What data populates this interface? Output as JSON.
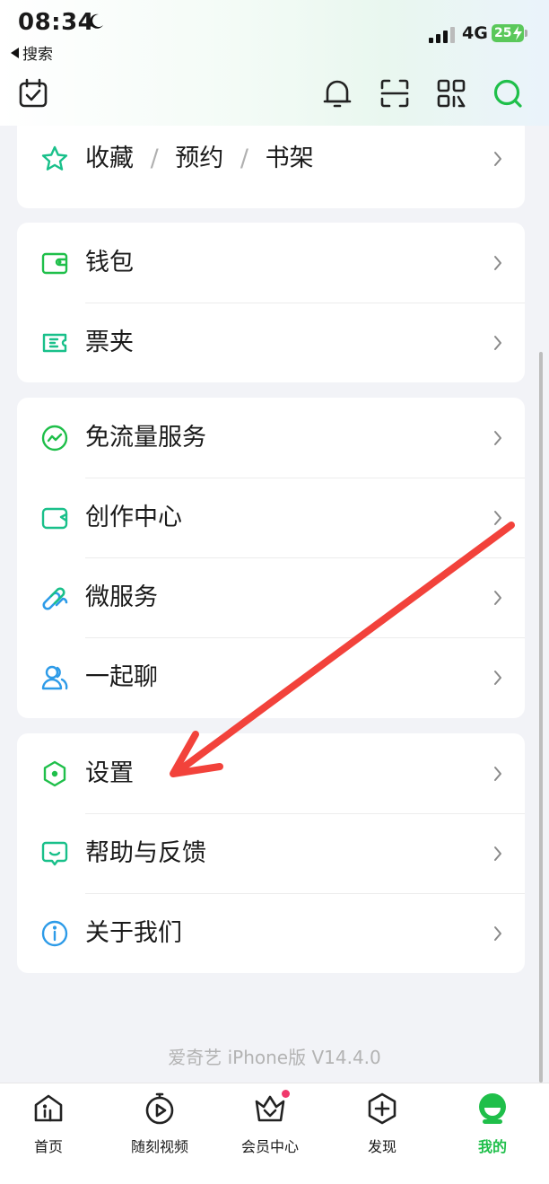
{
  "status_bar": {
    "time": "08:34",
    "back_label": "搜索",
    "network": "4G",
    "battery": "25"
  },
  "header_icons": [
    "calendar-check-icon",
    "bell-icon",
    "scan-icon",
    "qr-code-icon",
    "search-icon"
  ],
  "menu": {
    "favorites": {
      "label_a": "收藏",
      "sep1": "/",
      "label_b": "预约",
      "sep2": "/",
      "label_c": "书架"
    },
    "wallet": "钱包",
    "tickets": "票夹",
    "free_data": "免流量服务",
    "creator_center": "创作中心",
    "micro_services": "微服务",
    "chat_together": "一起聊",
    "settings": "设置",
    "help_feedback": "帮助与反馈",
    "about_us": "关于我们"
  },
  "version": "爱奇艺 iPhone版 V14.4.0",
  "tabbar": {
    "home": "首页",
    "moments": "随刻视频",
    "vip": "会员中心",
    "discover": "发现",
    "mine": "我的"
  },
  "colors": {
    "accent_green": "#1fbf4a",
    "icon_teal": "#19c08a",
    "icon_blue": "#2d9be8",
    "annotation_arrow": "#f2423b"
  }
}
